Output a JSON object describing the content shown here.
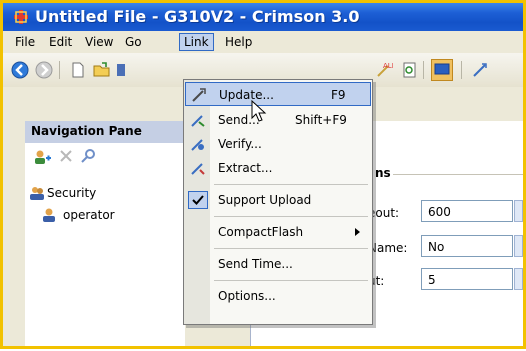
{
  "window": {
    "title": "Untitled File - G310V2 - Crimson 3.0"
  },
  "menubar": {
    "items": [
      {
        "label": "File"
      },
      {
        "label": "Edit"
      },
      {
        "label": "View"
      },
      {
        "label": "Go"
      },
      {
        "label": "Link"
      },
      {
        "label": "Help"
      }
    ]
  },
  "nav_pane": {
    "title": "Navigation Pane",
    "tree": [
      {
        "label": "Security"
      },
      {
        "label": "operator"
      }
    ]
  },
  "right_pane": {
    "group_title_fragment": "ns",
    "fields": [
      {
        "label_fragment": "eout:",
        "value": "600"
      },
      {
        "label_fragment": "Name:",
        "value": "No"
      },
      {
        "label_fragment": "ut:",
        "value": "5"
      }
    ]
  },
  "link_menu": {
    "items": [
      {
        "label": "Update...",
        "shortcut": "F9",
        "icon": "update-icon",
        "highlighted": true
      },
      {
        "label": "Send...",
        "shortcut": "Shift+F9",
        "icon": "send-icon"
      },
      {
        "label": "Verify...",
        "shortcut": "",
        "icon": "verify-icon"
      },
      {
        "label": "Extract...",
        "shortcut": "",
        "icon": "extract-icon"
      },
      {
        "label": "Support Upload",
        "shortcut": "",
        "icon": "checkmark-icon",
        "checked": true
      },
      {
        "label": "CompactFlash",
        "shortcut": "",
        "submenu": true
      },
      {
        "label": "Send Time...",
        "shortcut": ""
      },
      {
        "label": "Options...",
        "shortcut": ""
      }
    ]
  },
  "colors": {
    "titlebar": "#1d5fd5",
    "menu_highlight": "#c1d2ee",
    "frame_border": "#f2c200"
  }
}
